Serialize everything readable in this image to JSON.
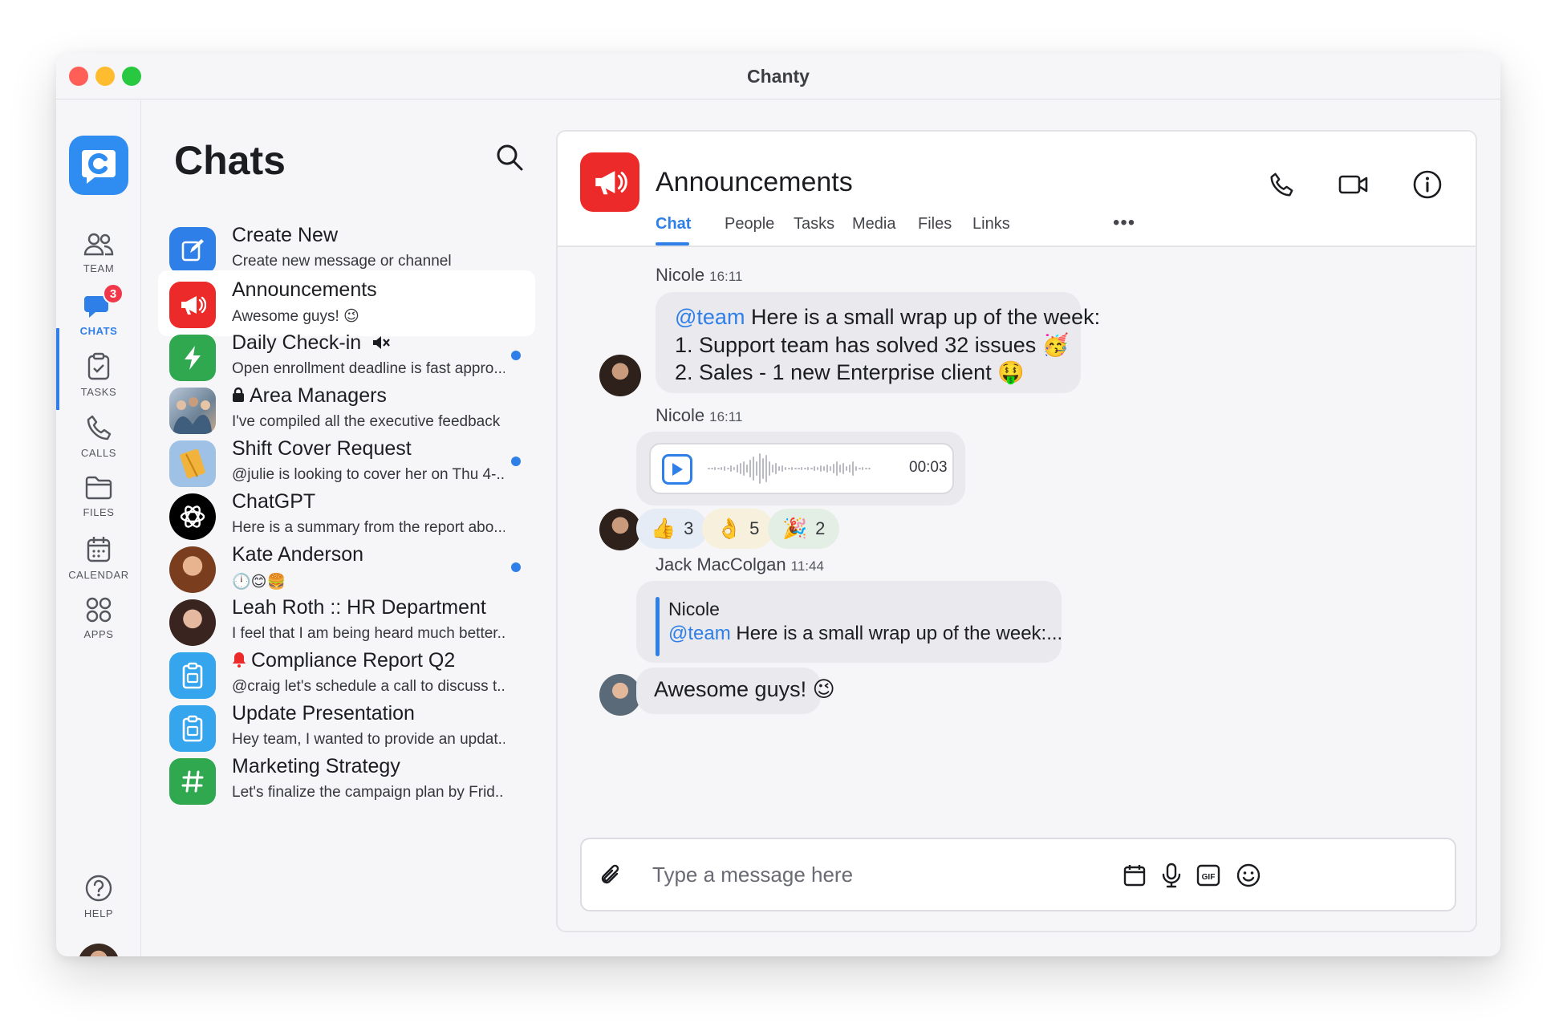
{
  "window": {
    "title": "Chanty"
  },
  "rail": {
    "items": [
      {
        "label": "TEAM",
        "icon": "team-icon"
      },
      {
        "label": "CHATS",
        "icon": "chats-icon",
        "badge": "3",
        "active": true
      },
      {
        "label": "TASKS",
        "icon": "tasks-icon"
      },
      {
        "label": "CALLS",
        "icon": "calls-icon"
      },
      {
        "label": "FILES",
        "icon": "files-icon"
      },
      {
        "label": "CALENDAR",
        "icon": "calendar-icon"
      },
      {
        "label": "APPS",
        "icon": "apps-icon"
      },
      {
        "label": "HELP",
        "icon": "help-icon"
      }
    ]
  },
  "chat_list": {
    "title": "Chats",
    "items": [
      {
        "name": "Create New",
        "preview": "Create new message or channel",
        "icon": "compose-icon",
        "color": "#2f7fe8"
      },
      {
        "name": "Announcements",
        "preview": "Awesome guys! 😉",
        "icon": "megaphone-icon",
        "color": "#ec2a2a",
        "selected": true
      },
      {
        "name": "Daily Check-in",
        "preview": "Open enrollment deadline is fast appro...",
        "icon": "bolt-icon",
        "color": "#2fa84f",
        "muted": true,
        "unread": true
      },
      {
        "name": "Area Managers",
        "preview": "I've compiled all the executive feedback",
        "icon": "group-photo",
        "locked": true
      },
      {
        "name": "Shift Cover Request",
        "preview": "@julie is looking to cover her on Thu 4-...",
        "icon": "notebook-image",
        "unread": true
      },
      {
        "name": "ChatGPT",
        "preview": "Here is a summary from the report abo...",
        "icon": "openai-icon",
        "color": "#000000"
      },
      {
        "name": "Kate Anderson",
        "preview": "🕛😊🍔",
        "icon": "avatar-photo",
        "unread": true
      },
      {
        "name": "Leah Roth :: HR Department",
        "preview": "I feel that I am being heard much better...",
        "icon": "avatar-photo"
      },
      {
        "name": "Compliance Report Q2",
        "preview": "@craig let's schedule a call to discuss t...",
        "icon": "clipboard-icon",
        "color": "#35a6ee",
        "alert": true
      },
      {
        "name": "Update Presentation",
        "preview": "Hey team, I wanted to provide an updat...",
        "icon": "clipboard-icon",
        "color": "#35a6ee"
      },
      {
        "name": "Marketing Strategy",
        "preview": "Let's finalize the campaign plan by Frid...",
        "icon": "hash-icon",
        "color": "#2fa84f"
      }
    ]
  },
  "conversation": {
    "title": "Announcements",
    "tabs": [
      "Chat",
      "People",
      "Tasks",
      "Media",
      "Files",
      "Links"
    ],
    "more_label": "•••",
    "messages": [
      {
        "sender": "Nicole",
        "time": "16:11",
        "mention": "@team",
        "line1": " Here is a small wrap up of the week:",
        "line2": "1. Support team has solved 32 issues 🥳",
        "line3": "2. Sales - 1 new Enterprise client 🤑"
      },
      {
        "sender": "Nicole",
        "time": "16:11",
        "audio_duration": "00:03",
        "audio_progress": 0
      },
      {
        "sender": "Jack MacColgan",
        "time": "11:44",
        "quote_author": "Nicole",
        "quote_mention": "@team",
        "quote_text": " Here is a small wrap up of the week:...",
        "reply": "Awesome guys! 😉"
      }
    ],
    "reactions": [
      {
        "emoji": "👍",
        "count": "3",
        "bg": "#e6ecf6"
      },
      {
        "emoji": "👌",
        "count": "5",
        "bg": "#f6f0dc"
      },
      {
        "emoji": "🎉",
        "count": "2",
        "bg": "#e3efe4"
      }
    ]
  },
  "composer": {
    "placeholder": "Type a message here"
  },
  "colors": {
    "accent": "#2f7fe8",
    "danger": "#ec2a2a",
    "success": "#2fa84f"
  }
}
